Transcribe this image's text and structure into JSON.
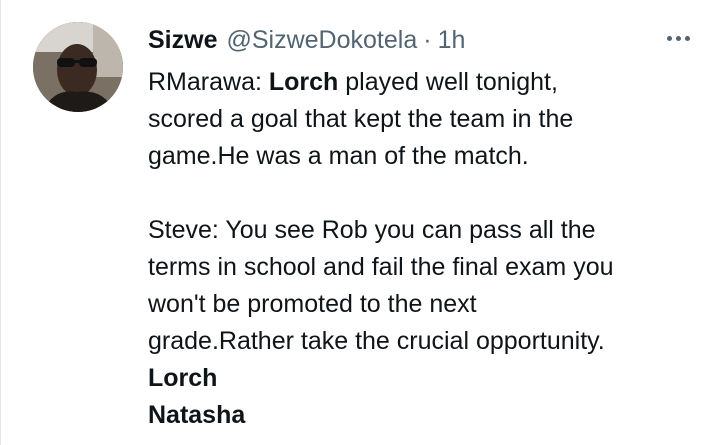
{
  "user": {
    "display_name": "Sizwe",
    "handle": "@SizweDokotela",
    "separator": "·",
    "timestamp": "1h"
  },
  "icons": {
    "more": "more-horizontal-icon"
  },
  "tweet": {
    "p1_prefix": "RMarawa: ",
    "p1_bold": "Lorch",
    "p1_rest": " played well tonight,",
    "p1_line2": "scored a goal that kept the team in the",
    "p1_line3": "game.He was a man of the match.",
    "p2_line1": "Steve: You see Rob you can pass all the",
    "p2_line2": "terms in school and fail the final exam you",
    "p2_line3": "won't be promoted to the next",
    "p2_line4": "grade.Rather take the crucial opportunity.",
    "tag1": "Lorch",
    "tag2": "Natasha"
  },
  "colors": {
    "text": "#0f1419",
    "secondary": "#536471",
    "background": "#ffffff"
  }
}
